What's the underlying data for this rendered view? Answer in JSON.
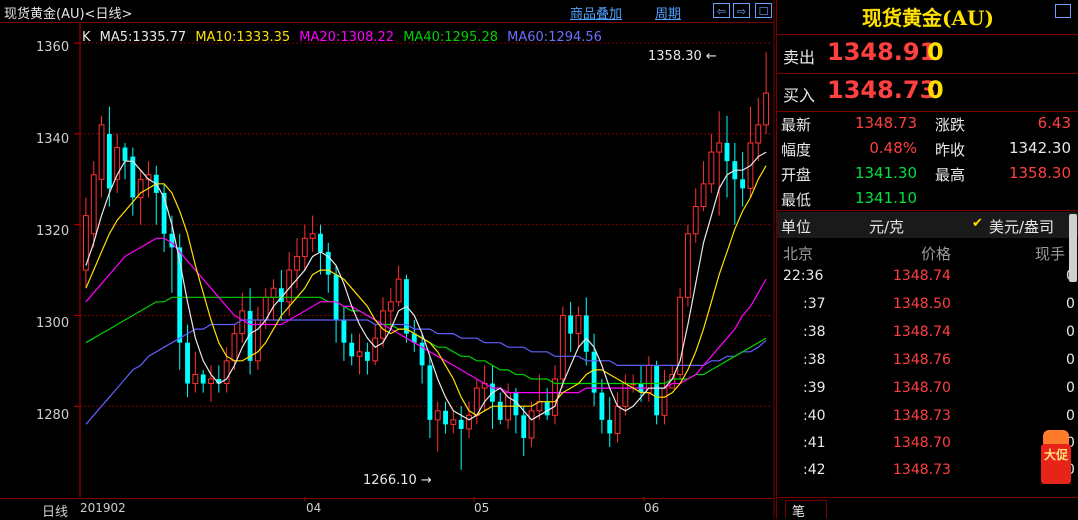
{
  "window": {
    "title": "现货黄金(AU)<日线>",
    "links": [
      "商品叠加",
      "周期"
    ],
    "buttons": [
      "⇦",
      "⇨",
      "☐"
    ],
    "maximize": "□"
  },
  "legend": {
    "k": "K",
    "ma5": "MA5:1335.77",
    "ma10": "MA10:1333.35",
    "ma20": "MA20:1308.22",
    "ma40": "MA40:1295.28",
    "ma60": "MA60:1294.56"
  },
  "annotations": {
    "high": "1358.30",
    "low": "1266.10"
  },
  "axis": {
    "y_labels": [
      "1360",
      "1340",
      "1320",
      "1300",
      "1280"
    ],
    "x_labels": [
      "201902",
      "04",
      "05",
      "06"
    ],
    "period_label": "日线"
  },
  "colors": {
    "up": "#ff3030",
    "down": "#00ffff",
    "ma5": "#e8e8e8",
    "ma10": "#ffe000",
    "ma20": "#ff00ff",
    "ma40": "#00d000",
    "ma60": "#6060ff",
    "grid": "#7a0000"
  },
  "chart_data": {
    "type": "candlestick",
    "ylim": [
      1260,
      1364
    ],
    "candles": [
      [
        1310,
        1322,
        1306,
        1326
      ],
      [
        1318,
        1331,
        1315,
        1334
      ],
      [
        1330,
        1342,
        1326,
        1344
      ],
      [
        1340,
        1328,
        1324,
        1346
      ],
      [
        1330,
        1337,
        1327,
        1340
      ],
      [
        1337,
        1334,
        1330,
        1338
      ],
      [
        1335,
        1326,
        1322,
        1337
      ],
      [
        1326,
        1330,
        1320,
        1332
      ],
      [
        1330,
        1331,
        1326,
        1334
      ],
      [
        1331,
        1327,
        1320,
        1333
      ],
      [
        1327,
        1318,
        1314,
        1329
      ],
      [
        1318,
        1315,
        1305,
        1322
      ],
      [
        1315,
        1294,
        1288,
        1318
      ],
      [
        1294,
        1285,
        1282,
        1298
      ],
      [
        1285,
        1287,
        1283,
        1292
      ],
      [
        1287,
        1285,
        1283,
        1288
      ],
      [
        1285,
        1286,
        1281,
        1289
      ],
      [
        1286,
        1285,
        1283,
        1289
      ],
      [
        1285,
        1290,
        1283,
        1293
      ],
      [
        1290,
        1296,
        1288,
        1298
      ],
      [
        1296,
        1301,
        1294,
        1305
      ],
      [
        1301,
        1290,
        1287,
        1306
      ],
      [
        1290,
        1299,
        1288,
        1302
      ],
      [
        1299,
        1304,
        1297,
        1306
      ],
      [
        1304,
        1306,
        1299,
        1308
      ],
      [
        1306,
        1303,
        1299,
        1310
      ],
      [
        1303,
        1310,
        1300,
        1314
      ],
      [
        1310,
        1313,
        1306,
        1317
      ],
      [
        1313,
        1317,
        1310,
        1320
      ],
      [
        1317,
        1318,
        1314,
        1322
      ],
      [
        1318,
        1314,
        1309,
        1320
      ],
      [
        1314,
        1309,
        1305,
        1316
      ],
      [
        1309,
        1299,
        1294,
        1311
      ],
      [
        1299,
        1294,
        1290,
        1302
      ],
      [
        1294,
        1291,
        1289,
        1296
      ],
      [
        1291,
        1292,
        1287,
        1296
      ],
      [
        1292,
        1290,
        1287,
        1294
      ],
      [
        1290,
        1295,
        1289,
        1298
      ],
      [
        1295,
        1301,
        1293,
        1304
      ],
      [
        1301,
        1303,
        1297,
        1306
      ],
      [
        1303,
        1308,
        1302,
        1311
      ],
      [
        1308,
        1296,
        1294,
        1309
      ],
      [
        1296,
        1294,
        1292,
        1299
      ],
      [
        1294,
        1289,
        1285,
        1296
      ],
      [
        1289,
        1277,
        1273,
        1291
      ],
      [
        1277,
        1279,
        1270,
        1281
      ],
      [
        1279,
        1276,
        1274,
        1281
      ],
      [
        1276,
        1277,
        1274,
        1279
      ],
      [
        1277,
        1275,
        1266,
        1280
      ],
      [
        1275,
        1278,
        1273,
        1281
      ],
      [
        1278,
        1284,
        1276,
        1286
      ],
      [
        1284,
        1285,
        1279,
        1289
      ],
      [
        1285,
        1281,
        1275,
        1289
      ],
      [
        1281,
        1277,
        1276,
        1283
      ],
      [
        1277,
        1283,
        1275,
        1285
      ],
      [
        1283,
        1278,
        1274,
        1284
      ],
      [
        1278,
        1273,
        1269,
        1280
      ],
      [
        1273,
        1279,
        1271,
        1281
      ],
      [
        1279,
        1281,
        1277,
        1287
      ],
      [
        1281,
        1278,
        1277,
        1284
      ],
      [
        1278,
        1286,
        1276,
        1289
      ],
      [
        1286,
        1300,
        1284,
        1302
      ],
      [
        1300,
        1296,
        1292,
        1303
      ],
      [
        1296,
        1300,
        1293,
        1302
      ],
      [
        1300,
        1292,
        1289,
        1304
      ],
      [
        1292,
        1283,
        1280,
        1296
      ],
      [
        1283,
        1277,
        1274,
        1286
      ],
      [
        1277,
        1274,
        1271,
        1282
      ],
      [
        1274,
        1280,
        1272,
        1283
      ],
      [
        1280,
        1285,
        1278,
        1287
      ],
      [
        1285,
        1285,
        1283,
        1287
      ],
      [
        1285,
        1283,
        1281,
        1289
      ],
      [
        1283,
        1289,
        1281,
        1291
      ],
      [
        1289,
        1278,
        1276,
        1290
      ],
      [
        1278,
        1284,
        1276,
        1288
      ],
      [
        1284,
        1287,
        1284,
        1289
      ],
      [
        1287,
        1304,
        1286,
        1306
      ],
      [
        1304,
        1318,
        1302,
        1320
      ],
      [
        1318,
        1324,
        1316,
        1328
      ],
      [
        1324,
        1329,
        1323,
        1334
      ],
      [
        1329,
        1336,
        1327,
        1340
      ],
      [
        1336,
        1338,
        1322,
        1345
      ],
      [
        1338,
        1334,
        1326,
        1344
      ],
      [
        1334,
        1330,
        1320,
        1338
      ],
      [
        1330,
        1328,
        1324,
        1336
      ],
      [
        1328,
        1338,
        1326,
        1346
      ],
      [
        1338,
        1342,
        1334,
        1348
      ],
      [
        1342,
        1349,
        1340,
        1358
      ]
    ],
    "ma5": [
      1311,
      1316,
      1322,
      1327,
      1331,
      1334,
      1334,
      1332,
      1330,
      1329,
      1326,
      1320,
      1312,
      1303,
      1295,
      1290,
      1287,
      1285,
      1286,
      1289,
      1293,
      1296,
      1297,
      1299,
      1302,
      1304,
      1306,
      1308,
      1310,
      1313,
      1314,
      1313,
      1311,
      1307,
      1302,
      1298,
      1295,
      1293,
      1294,
      1297,
      1301,
      1302,
      1300,
      1296,
      1291,
      1286,
      1282,
      1279,
      1278,
      1277,
      1278,
      1281,
      1283,
      1284,
      1282,
      1281,
      1279,
      1277,
      1278,
      1279,
      1280,
      1285,
      1289,
      1293,
      1295,
      1293,
      1289,
      1284,
      1280,
      1279,
      1280,
      1282,
      1284,
      1284,
      1284,
      1286,
      1290,
      1298,
      1307,
      1316,
      1322,
      1328,
      1331,
      1332,
      1332,
      1333,
      1335,
      1336
    ],
    "ma10": [
      1306,
      1310,
      1314,
      1318,
      1321,
      1323,
      1325,
      1327,
      1328,
      1329,
      1329,
      1327,
      1323,
      1318,
      1311,
      1305,
      1299,
      1294,
      1291,
      1290,
      1290,
      1291,
      1292,
      1294,
      1297,
      1300,
      1302,
      1304,
      1306,
      1309,
      1310,
      1310,
      1309,
      1308,
      1306,
      1304,
      1302,
      1299,
      1297,
      1296,
      1297,
      1297,
      1296,
      1295,
      1294,
      1292,
      1289,
      1286,
      1282,
      1279,
      1278,
      1279,
      1280,
      1280,
      1280,
      1280,
      1280,
      1280,
      1281,
      1281,
      1281,
      1283,
      1284,
      1285,
      1287,
      1288,
      1288,
      1287,
      1286,
      1285,
      1284,
      1283,
      1283,
      1282,
      1282,
      1283,
      1285,
      1288,
      1292,
      1297,
      1303,
      1309,
      1314,
      1319,
      1323,
      1326,
      1330,
      1333
    ],
    "ma20": [
      1303,
      1305,
      1307,
      1309,
      1311,
      1313,
      1314,
      1315,
      1316,
      1317,
      1317,
      1316,
      1314,
      1312,
      1310,
      1308,
      1306,
      1304,
      1302,
      1300,
      1299,
      1298,
      1298,
      1298,
      1298,
      1298,
      1299,
      1300,
      1301,
      1302,
      1303,
      1303,
      1303,
      1302,
      1302,
      1301,
      1300,
      1299,
      1298,
      1297,
      1296,
      1295,
      1294,
      1293,
      1292,
      1291,
      1290,
      1289,
      1288,
      1287,
      1286,
      1285,
      1284,
      1284,
      1283,
      1283,
      1283,
      1283,
      1283,
      1283,
      1283,
      1283,
      1283,
      1283,
      1284,
      1284,
      1284,
      1284,
      1284,
      1284,
      1284,
      1284,
      1284,
      1284,
      1284,
      1285,
      1285,
      1286,
      1287,
      1289,
      1291,
      1293,
      1295,
      1297,
      1300,
      1302,
      1305,
      1308
    ],
    "ma40": [
      1294,
      1295,
      1296,
      1297,
      1298,
      1299,
      1300,
      1301,
      1302,
      1303,
      1303,
      1304,
      1304,
      1304,
      1304,
      1304,
      1304,
      1304,
      1304,
      1304,
      1304,
      1304,
      1304,
      1304,
      1304,
      1304,
      1304,
      1304,
      1304,
      1304,
      1304,
      1303,
      1303,
      1302,
      1301,
      1301,
      1300,
      1299,
      1298,
      1298,
      1297,
      1297,
      1296,
      1295,
      1294,
      1293,
      1293,
      1292,
      1291,
      1291,
      1290,
      1290,
      1289,
      1288,
      1288,
      1287,
      1287,
      1286,
      1286,
      1286,
      1285,
      1285,
      1285,
      1285,
      1285,
      1285,
      1285,
      1285,
      1285,
      1285,
      1285,
      1285,
      1285,
      1285,
      1285,
      1286,
      1286,
      1286,
      1287,
      1287,
      1288,
      1289,
      1290,
      1291,
      1292,
      1293,
      1294,
      1295
    ],
    "ma60": [
      1276,
      1278,
      1280,
      1282,
      1284,
      1286,
      1288,
      1289,
      1291,
      1292,
      1293,
      1294,
      1295,
      1296,
      1297,
      1297,
      1298,
      1298,
      1298,
      1298,
      1299,
      1299,
      1299,
      1299,
      1299,
      1299,
      1299,
      1299,
      1299,
      1299,
      1299,
      1299,
      1299,
      1299,
      1299,
      1299,
      1299,
      1298,
      1298,
      1298,
      1298,
      1298,
      1297,
      1297,
      1297,
      1296,
      1296,
      1296,
      1295,
      1295,
      1295,
      1294,
      1294,
      1294,
      1293,
      1293,
      1293,
      1292,
      1292,
      1292,
      1291,
      1291,
      1291,
      1291,
      1290,
      1290,
      1290,
      1290,
      1289,
      1289,
      1289,
      1289,
      1289,
      1289,
      1289,
      1289,
      1289,
      1289,
      1289,
      1289,
      1290,
      1290,
      1291,
      1291,
      1292,
      1292,
      1293,
      1294.5
    ]
  },
  "panel": {
    "title": "现货黄金(AU)",
    "sell_label": "卖出",
    "sell_price": "1348.91",
    "sell_qty": "0",
    "buy_label": "买入",
    "buy_price": "1348.73",
    "buy_qty": "0",
    "stats": [
      {
        "label": "最新",
        "value": "1348.73",
        "label2": "涨跌",
        "value2": "6.43"
      },
      {
        "label": "幅度",
        "value": "0.48%",
        "label2": "昨收",
        "value2": "1342.30"
      },
      {
        "label": "开盘",
        "value": "1341.30",
        "label2": "最高",
        "value2": "1358.30"
      },
      {
        "label": "最低",
        "value": "1341.10",
        "label2": "",
        "value2": ""
      }
    ],
    "unit_label": "单位",
    "unit_value": "元/克",
    "unit_alt": "美元/盎司",
    "tick_header": {
      "time": "北京",
      "price": "价格",
      "vol": "现手"
    },
    "ticks": [
      {
        "time": "22:36",
        "price": "1348.74",
        "vol": "0"
      },
      {
        "time": ":37",
        "price": "1348.50",
        "vol": "0"
      },
      {
        "time": ":38",
        "price": "1348.74",
        "vol": "0"
      },
      {
        "time": ":38",
        "price": "1348.76",
        "vol": "0"
      },
      {
        "time": ":39",
        "price": "1348.70",
        "vol": "0"
      },
      {
        "time": ":40",
        "price": "1348.73",
        "vol": "0"
      },
      {
        "time": ":41",
        "price": "1348.70",
        "vol": "0"
      },
      {
        "time": ":42",
        "price": "1348.73",
        "vol": "0"
      }
    ],
    "footer_tab": "笔",
    "promo": "大促"
  }
}
